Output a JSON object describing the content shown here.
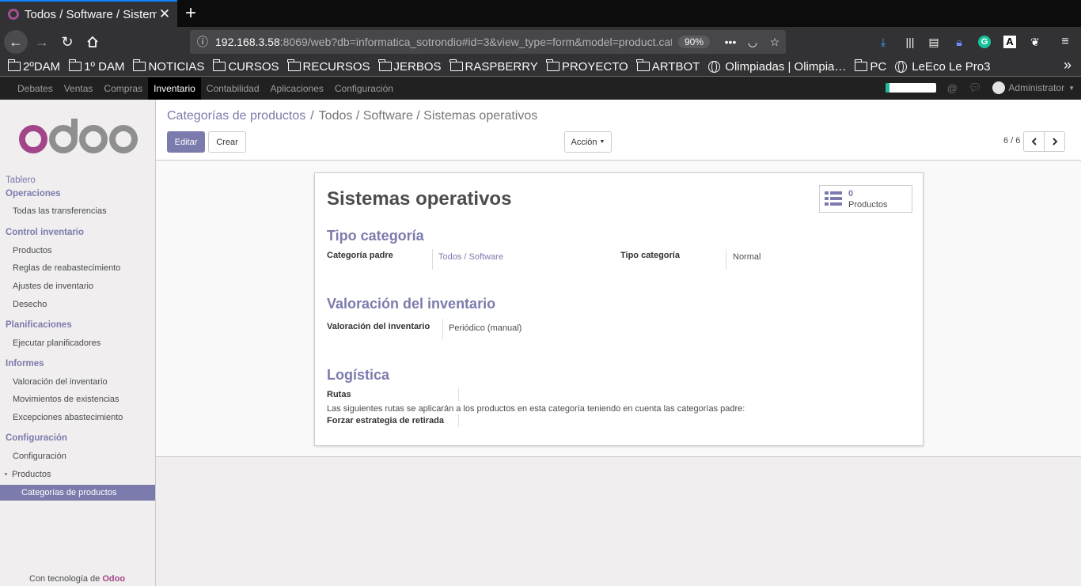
{
  "browser": {
    "tab_title": "Todos / Software / Sistemas operativos",
    "url_host": "192.168.3.58",
    "url_rest": ":8069/web?db=informatica_sotrondio#id=3&view_type=form&model=product.category",
    "zoom": "90%",
    "bookmarks": [
      "2ºDAM",
      "1º DAM",
      "NOTICIAS",
      "CURSOS",
      "RECURSOS",
      "JERBOS",
      "RASPBERRY",
      "PROYECTO",
      "ARTBOT",
      "Olimpiadas | Olimpia…",
      "PC",
      "LeEco Le Pro3"
    ]
  },
  "topmenu": {
    "items": [
      "Debates",
      "Ventas",
      "Compras",
      "Inventario",
      "Contabilidad",
      "Aplicaciones",
      "Configuración"
    ],
    "user": "Administrator",
    "progress": 0.08,
    "progress_color": "#21b799"
  },
  "sidebar": {
    "tablero": "Tablero",
    "operaciones": "Operaciones",
    "todas_transferencias": "Todas las transferencias",
    "control": "Control inventario",
    "productos": "Productos",
    "reglas": "Reglas de reabastecimiento",
    "ajustes": "Ajustes de inventario",
    "desecho": "Desecho",
    "planificaciones": "Planificaciones",
    "ejecutar": "Ejecutar planificadores",
    "informes": "Informes",
    "valoracion": "Valoración del inventario",
    "movimientos": "Movimientos de existencias",
    "excepciones": "Excepciones abastecimiento",
    "configuracion_sec": "Configuración",
    "configuracion_item": "Configuración",
    "productos2": "Productos",
    "categorias": "Categorías de productos",
    "footer_prefix": "Con tecnología de ",
    "footer_brand": "Odoo"
  },
  "control_panel": {
    "breadcrumb_link": "Categorías de productos",
    "breadcrumb_sep": "/",
    "breadcrumb_current": "Todos / Software / Sistemas operativos",
    "edit": "Editar",
    "create": "Crear",
    "action": "Acción",
    "pager": "6 / 6"
  },
  "form": {
    "title": "Sistemas operativos",
    "stat_count": "0",
    "stat_label": "Productos",
    "section_tipo": "Tipo categoría",
    "parent_label": "Categoría padre",
    "parent_value": "Todos / Software",
    "type_label": "Tipo categoría",
    "type_value": "Normal",
    "section_valoracion": "Valoración del inventario",
    "valuation_label": "Valoración del inventario",
    "valuation_value": "Periódico (manual)",
    "section_logistica": "Logística",
    "routes_label": "Rutas",
    "routes_help": "Las siguientes rutas se aplicarán a los productos en esta categoría teniendo en cuenta las categorías padre:",
    "removal_label": "Forzar estrategia de retirada"
  },
  "colors": {
    "brand_purple": "#7c7bad",
    "odoo_logo": "#a24689"
  }
}
